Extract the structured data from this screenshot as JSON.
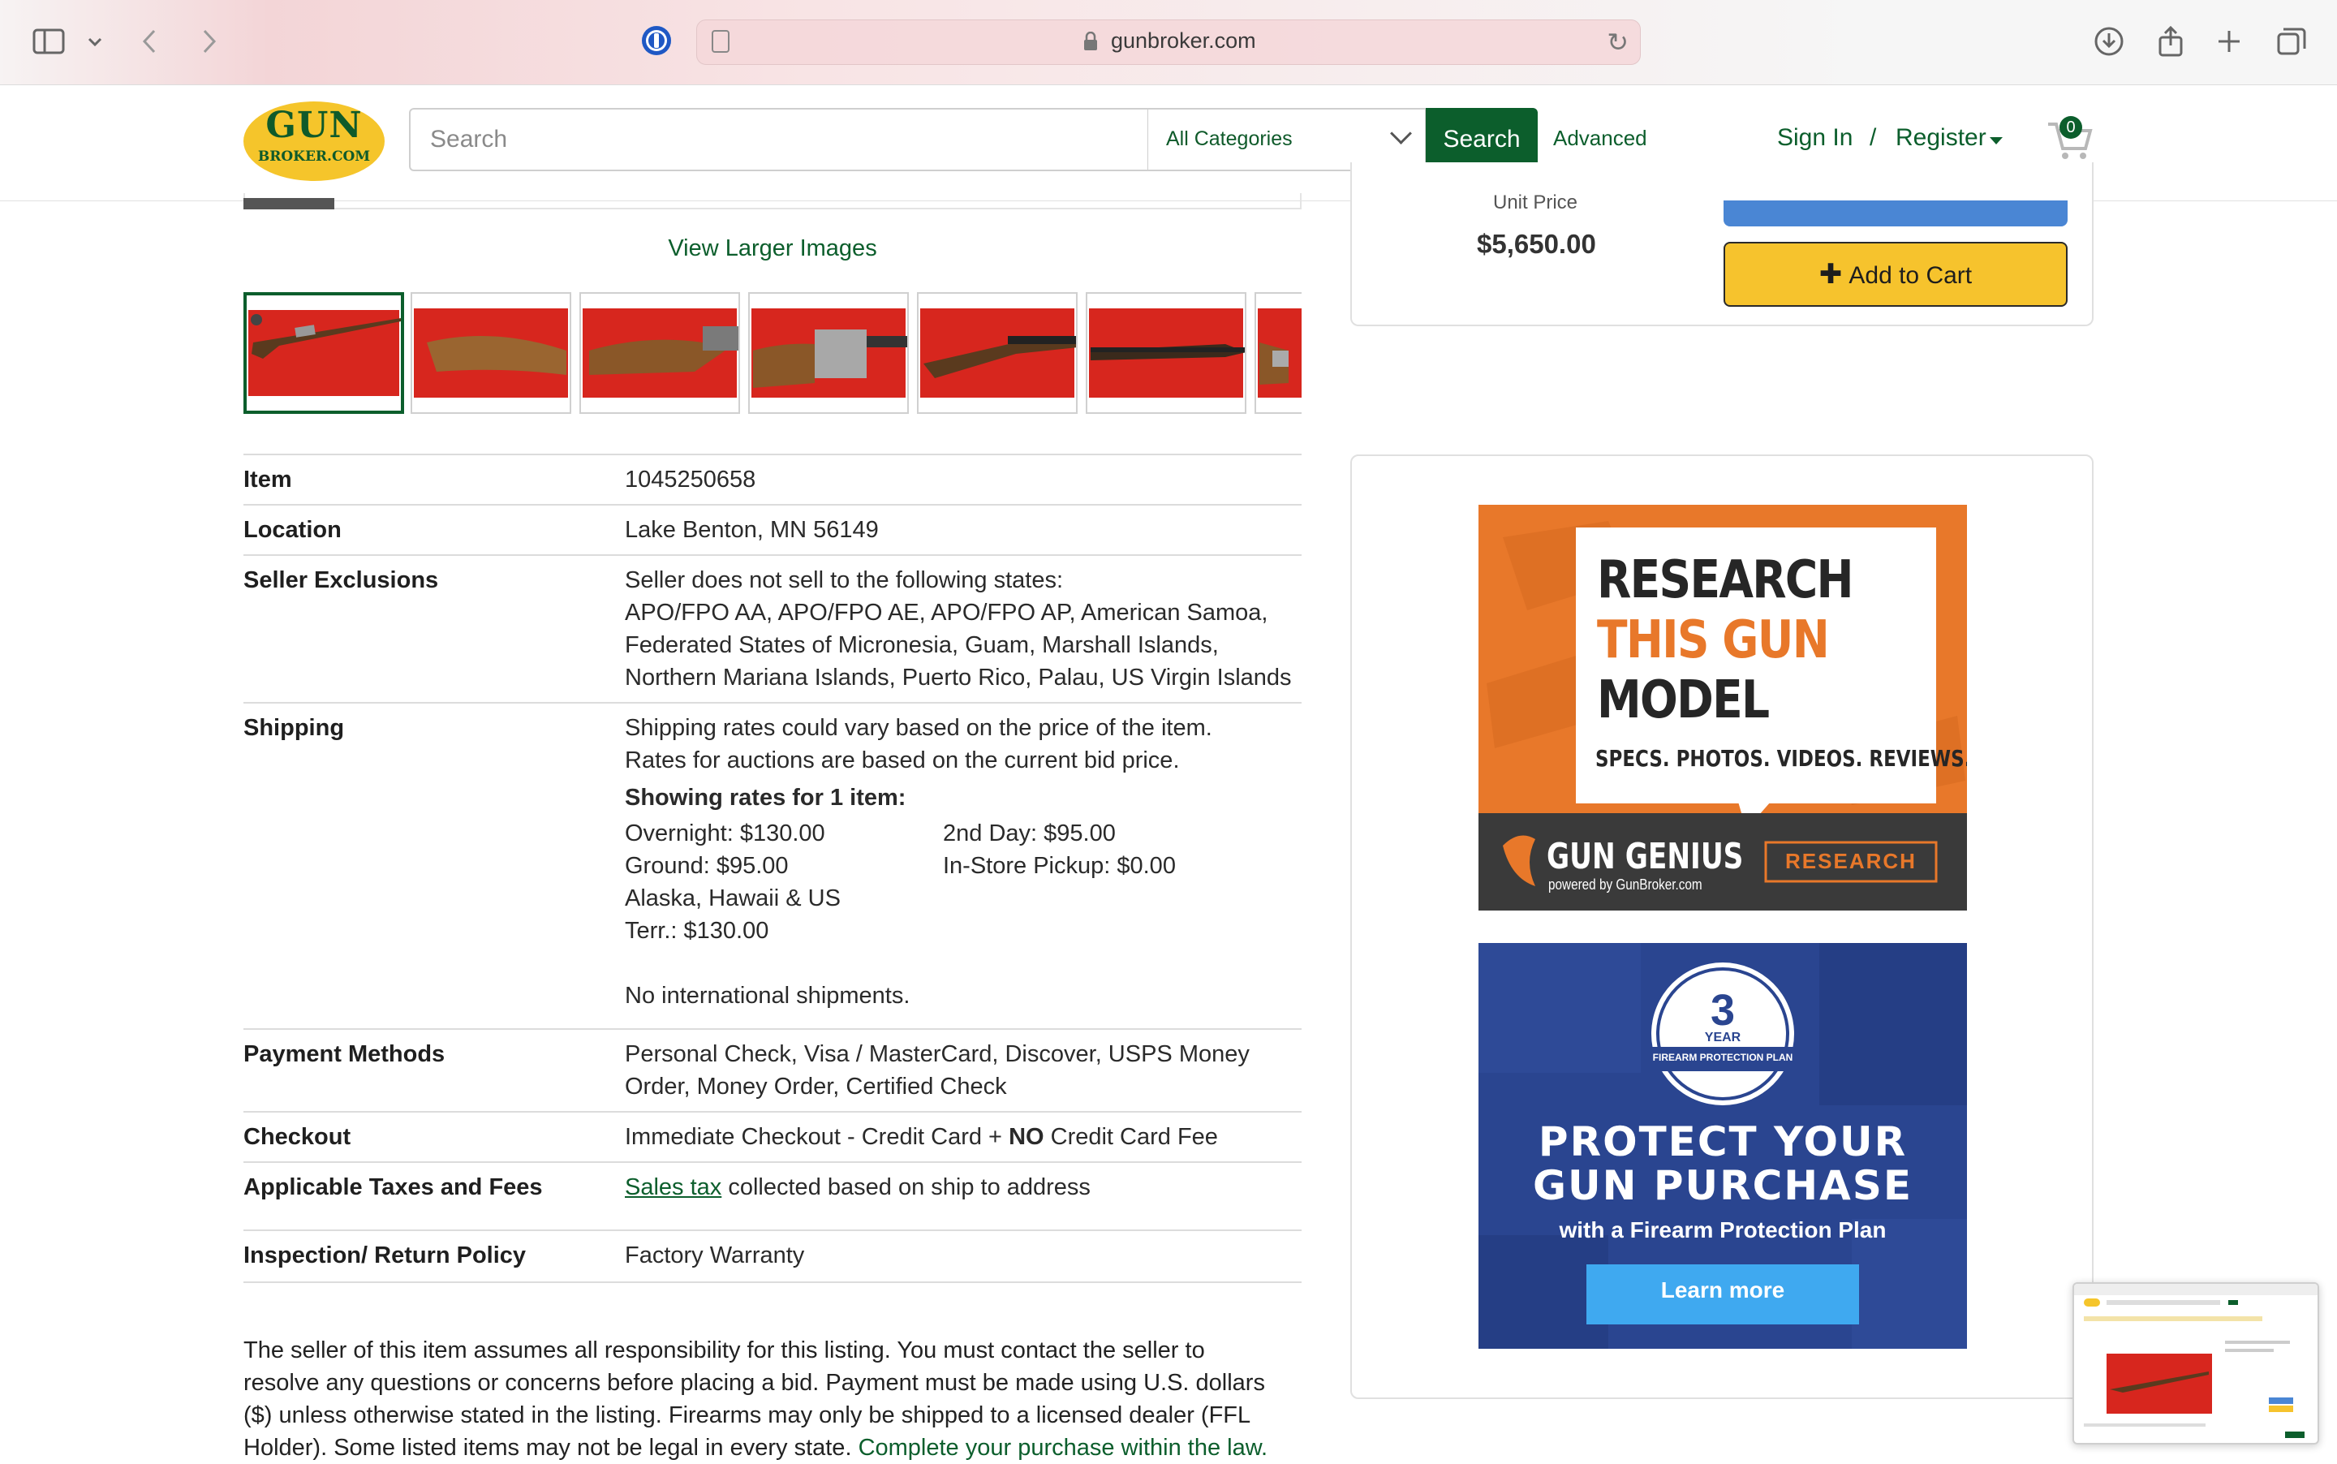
{
  "browser": {
    "domain": "gunbroker.com"
  },
  "header": {
    "logo_top": "GUN",
    "logo_bottom": "BROKER.COM",
    "search_placeholder": "Search",
    "category": "All Categories",
    "search_button": "Search",
    "advanced_link": "Advanced",
    "sign_in": "Sign In",
    "separator": "/",
    "register": "Register",
    "cart_count": "0"
  },
  "gallery": {
    "view_larger": "View Larger Images"
  },
  "purchase": {
    "unit_price_label": "Unit Price",
    "unit_price": "$5,650.00",
    "add_to_cart": "Add to Cart"
  },
  "details": {
    "item": {
      "label": "Item",
      "value": "1045250658"
    },
    "location": {
      "label": "Location",
      "value": "Lake Benton, MN 56149"
    },
    "exclusions": {
      "label": "Seller Exclusions",
      "lines": [
        "Seller does not sell to the following states:",
        "APO/FPO AA, APO/FPO AE, APO/FPO AP, American Samoa,",
        "Federated States of Micronesia, Guam, Marshall Islands,",
        "Northern Mariana Islands, Puerto Rico, Palau, US Virgin Islands"
      ]
    },
    "shipping": {
      "label": "Shipping",
      "lines": [
        "Shipping rates could vary based on the price of the item.",
        "Rates for auctions are based on the current bid price."
      ],
      "rates_heading": "Showing rates for 1 item:",
      "rates_left": [
        "Overnight: $130.00",
        "Ground: $95.00",
        "Alaska, Hawaii & US",
        "Terr.: $130.00"
      ],
      "rates_right": [
        "2nd Day: $95.00",
        "In-Store Pickup: $0.00"
      ],
      "international": "No international shipments."
    },
    "payment": {
      "label": "Payment Methods",
      "lines": [
        "Personal Check, Visa / MasterCard, Discover, USPS Money",
        "Order, Money Order, Certified Check"
      ]
    },
    "checkout": {
      "label": "Checkout",
      "part1": "Immediate Checkout - Credit Card +",
      "bold": "NO",
      "part2": "Credit Card Fee"
    },
    "taxes": {
      "label": "Applicable Taxes and Fees",
      "link": "Sales tax",
      "rest": "collected based on ship to address"
    },
    "returns": {
      "label": "Inspection/ Return Policy",
      "value": "Factory Warranty"
    }
  },
  "disclaimer": {
    "lines": [
      "The seller of this item assumes all responsibility for this listing. You must contact the seller to",
      "resolve any questions or concerns before placing a bid. Payment must be made using U.S. dollars",
      "($) unless otherwise stated in the listing. Firearms may only be shipped to a licensed dealer (FFL"
    ],
    "last_line": "Holder). Some listed items may not be legal in every state.",
    "last_link": "Complete your purchase within the law."
  },
  "ads": {
    "research": {
      "line1": "RESEARCH",
      "line2": "THIS GUN",
      "line3": "MODEL",
      "tagline": "SPECS. PHOTOS. VIDEOS. REVIEWS.",
      "brand": "GUN GENIUS",
      "powered": "powered by GunBroker.com",
      "button": "RESEARCH"
    },
    "protection": {
      "badge_number": "3",
      "badge_year": "YEAR",
      "badge_text": "FIREARM PROTECTION PLAN",
      "line1": "PROTECT YOUR",
      "line2": "GUN PURCHASE",
      "sub": "with a Firearm Protection Plan",
      "button": "Learn more"
    }
  },
  "colors": {
    "brand_green": "#0c5e2c",
    "logo_yellow": "#f5c52b",
    "add_cart_yellow": "#f6c32d",
    "photo_red": "#d7261e"
  }
}
